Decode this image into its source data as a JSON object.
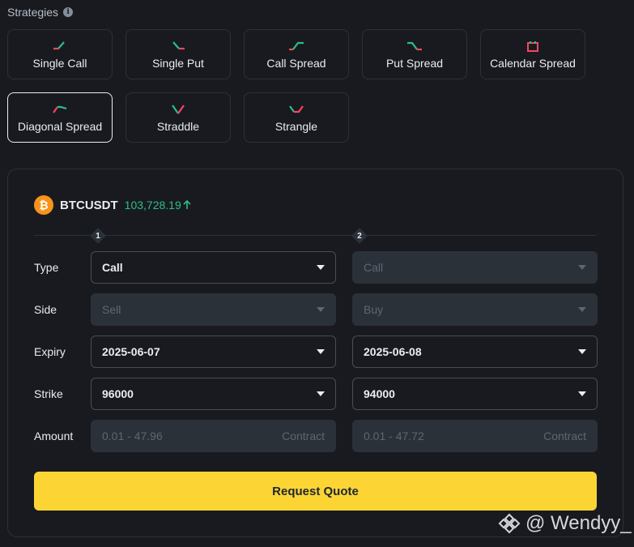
{
  "header": {
    "title": "Strategies",
    "info_icon": "info-icon"
  },
  "strategies": [
    {
      "label": "Single Call",
      "icon": "single-call-icon"
    },
    {
      "label": "Single Put",
      "icon": "single-put-icon"
    },
    {
      "label": "Call Spread",
      "icon": "call-spread-icon"
    },
    {
      "label": "Put Spread",
      "icon": "put-spread-icon"
    },
    {
      "label": "Calendar Spread",
      "icon": "calendar-spread-icon"
    },
    {
      "label": "Diagonal Spread",
      "icon": "diagonal-spread-icon",
      "selected": true
    },
    {
      "label": "Straddle",
      "icon": "straddle-icon"
    },
    {
      "label": "Strangle",
      "icon": "strangle-icon"
    }
  ],
  "colors": {
    "up": "#2ebd85",
    "down": "#f6465d",
    "accent": "#fcd535",
    "btc": "#f7931a"
  },
  "ticker": {
    "symbol": "BTCUSDT",
    "price": "103,728.19",
    "direction": "up"
  },
  "legs": [
    "1",
    "2"
  ],
  "rows": {
    "type": {
      "label": "Type",
      "leg1": "Call",
      "leg2": "Call"
    },
    "side": {
      "label": "Side",
      "leg1": "Sell",
      "leg2": "Buy"
    },
    "expiry": {
      "label": "Expiry",
      "leg1": "2025-06-07",
      "leg2": "2025-06-08"
    },
    "strike": {
      "label": "Strike",
      "leg1": "96000",
      "leg2": "94000"
    },
    "amount": {
      "label": "Amount",
      "leg1_placeholder": "0.01 - 47.96",
      "leg2_placeholder": "0.01 - 47.72",
      "unit": "Contract"
    }
  },
  "actions": {
    "request_quote": "Request Quote"
  },
  "watermark": {
    "text": "@ Wendyy_"
  }
}
